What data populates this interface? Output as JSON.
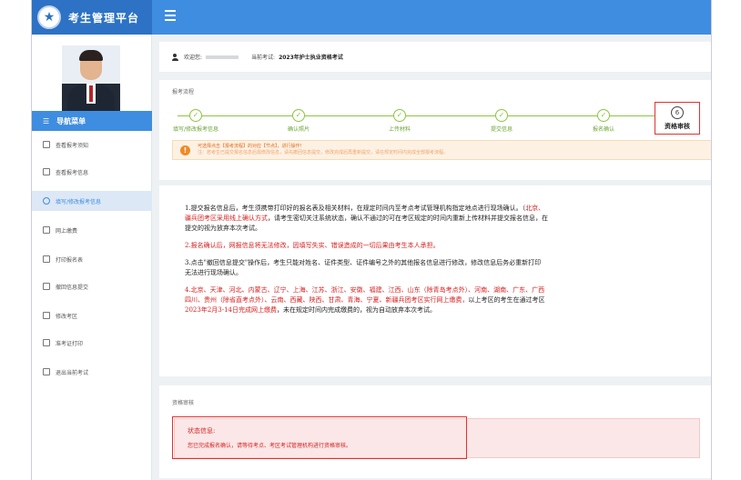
{
  "app": {
    "title": "考生管理平台",
    "logo_glyph": "★"
  },
  "nav": {
    "header": "导航菜单",
    "items": [
      {
        "label": "查看报考须知",
        "active": false
      },
      {
        "label": "查看报考信息",
        "active": false
      },
      {
        "label": "填写/修改报考信息",
        "active": true
      },
      {
        "label": "网上缴费",
        "active": false
      },
      {
        "label": "打印报名表",
        "active": false
      },
      {
        "label": "撤回信息提交",
        "active": false
      },
      {
        "label": "修改考区",
        "active": false
      },
      {
        "label": "准考证打印",
        "active": false
      },
      {
        "label": "退出当前考试",
        "active": false
      }
    ]
  },
  "welcome": {
    "greeting_label": "欢迎您:",
    "current_exam_label": "当前考试:",
    "current_exam": "2023年护士执业资格考试"
  },
  "process": {
    "title": "报考流程",
    "steps": [
      {
        "label": "填写/修改报考信息",
        "done": true
      },
      {
        "label": "确认照片",
        "done": true
      },
      {
        "label": "上传材料",
        "done": true
      },
      {
        "label": "提交信息",
        "done": true
      },
      {
        "label": "报名确认",
        "done": true
      },
      {
        "label": "资格审核",
        "done": false,
        "number": "6"
      }
    ],
    "notice_line1": "可选择点击【报考流程】的对应【节点】，进行操作!",
    "notice_line2": "注：若考生已提交报名信息后需修改信息，请先撤回信息提交，修改完成后再重新提交，请在规定时间内完成全部报考流程。"
  },
  "instructions": {
    "p1_line1_a": "1.提交报名信息后，考生须携带打印好的报名表及相关材料，在规定时间内至考点考试管理机构指定地点进行现场确认。（",
    "p1_line1_b": "北京、",
    "p1_line2_a": "疆兵团考区采用线上确认方式",
    "p1_line2_b": "，请考生密切关注系统状态，确认不通过的可在考区规定的时间内重新上传材料并提交报名信息，在",
    "p1_line3": "提交的视为放弃本次考试。",
    "p2": "2.报名确认后，网报信息将无法修改，因填写失实、错误造成的一切后果由考生本人承担。",
    "p3_line1": "3.点击\"撤回信息提交\"操作后，考生只能对姓名、证件类型、证件编号之外的其他报名信息进行修改，修改信息后务必重新打印",
    "p3_line2": "无法进行现场确认。",
    "p4_line1_a": "4.北京、天津、河北、内蒙古、辽宁、上海、江苏、浙江、安徽、福建、江西、山东（除青岛考点外）、河南、湖南、广东、广西",
    "p4_line2_a": "四川、贵州（除省直考点外）、云南、西藏、陕西、甘肃、青海、宁夏、新疆兵团考区实行网上缴费，",
    "p4_line2_b": "以上考区的考生在通过考区",
    "p4_line3_a": "2023年2月3-14日完成网上缴费",
    "p4_line3_b": "，未在规定时间内完成缴费的，视为自动放弃本次考试。"
  },
  "review": {
    "title": "资格审核",
    "status_title": "状态信息:",
    "status_text": "您已完成报名确认，请等待考点、考区考试管理机构进行资格审核。"
  },
  "colors": {
    "topbar": "#3f8de0",
    "brand": "#2d72c4",
    "step_done": "#8cc63f",
    "highlight": "#e03232",
    "text_red": "#d62020",
    "notice_orange": "#f08a24"
  }
}
